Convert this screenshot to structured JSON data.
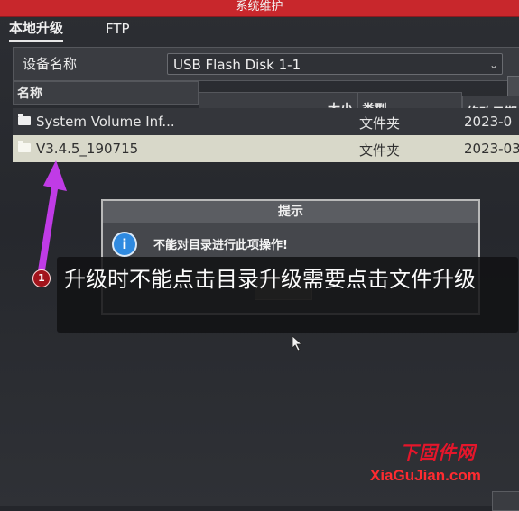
{
  "window": {
    "title": "系统维护"
  },
  "tabs": [
    {
      "label": "本地升级",
      "active": true
    },
    {
      "label": "FTP",
      "active": false
    }
  ],
  "device": {
    "label": "设备名称",
    "selected": "USB Flash Disk 1-1"
  },
  "table": {
    "columns": [
      "名称",
      "大小",
      "类型",
      "修改日期"
    ],
    "rows": [
      {
        "name": "System Volume Inf...",
        "size": "",
        "type": "文件夹",
        "date": "2023-0"
      },
      {
        "name": "V3.4.5_190715",
        "size": "",
        "type": "文件夹",
        "date": "2023-03",
        "selected": true
      }
    ]
  },
  "dialog": {
    "title": "提示",
    "icon": "info-icon",
    "message": "不能对目录进行此项操作!"
  },
  "annotation": {
    "badge": "1",
    "text": "升级时不能点击目录升级需要点击文件升级",
    "arrow_color": "#c83cf0"
  },
  "watermark": {
    "cn": "下固件网",
    "en": "XiaGuJian.com"
  },
  "colors": {
    "title_bar": "#c8272c",
    "selected_row": "#d8d8c9",
    "watermark": "#e5162b"
  }
}
